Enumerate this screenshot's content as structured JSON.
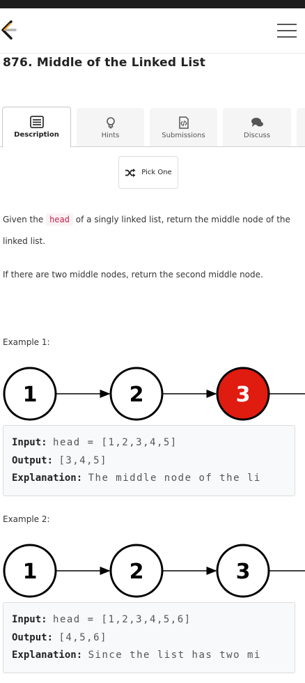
{
  "problem": {
    "title": "876. Middle of the Linked List"
  },
  "tabs": [
    {
      "label": "Description",
      "icon": "description-icon"
    },
    {
      "label": "Hints",
      "icon": "lightbulb-icon"
    },
    {
      "label": "Submissions",
      "icon": "code-file-icon"
    },
    {
      "label": "Discuss",
      "icon": "chat-bubbles-icon"
    }
  ],
  "pick_one": {
    "label": "Pick One",
    "icon": "shuffle-icon"
  },
  "description": {
    "p1_before": "Given the",
    "p1_code": "head",
    "p1_after": "of a singly linked list, return the middle node of the linked list.",
    "p2": "If there are two middle nodes, return the second middle node."
  },
  "examples": [
    {
      "label": "Example 1:",
      "nodes": [
        "1",
        "2",
        "3"
      ],
      "highlight_index": 2,
      "input_label": "Input:",
      "input_value": "head = [1,2,3,4,5]",
      "output_label": "Output:",
      "output_value": "[3,4,5]",
      "explanation_label": "Explanation:",
      "explanation_value": "The middle node of the li"
    },
    {
      "label": "Example 2:",
      "nodes": [
        "1",
        "2",
        "3"
      ],
      "highlight_index": -1,
      "input_label": "Input:",
      "input_value": "head = [1,2,3,4,5,6]",
      "output_label": "Output:",
      "output_value": "[4,5,6]",
      "explanation_label": "Explanation:",
      "explanation_value": "Since the list has two mi"
    }
  ],
  "colors": {
    "accent_red": "#e01b10",
    "code_pink": "#c7254e",
    "logo_orange": "#f89f1b"
  }
}
